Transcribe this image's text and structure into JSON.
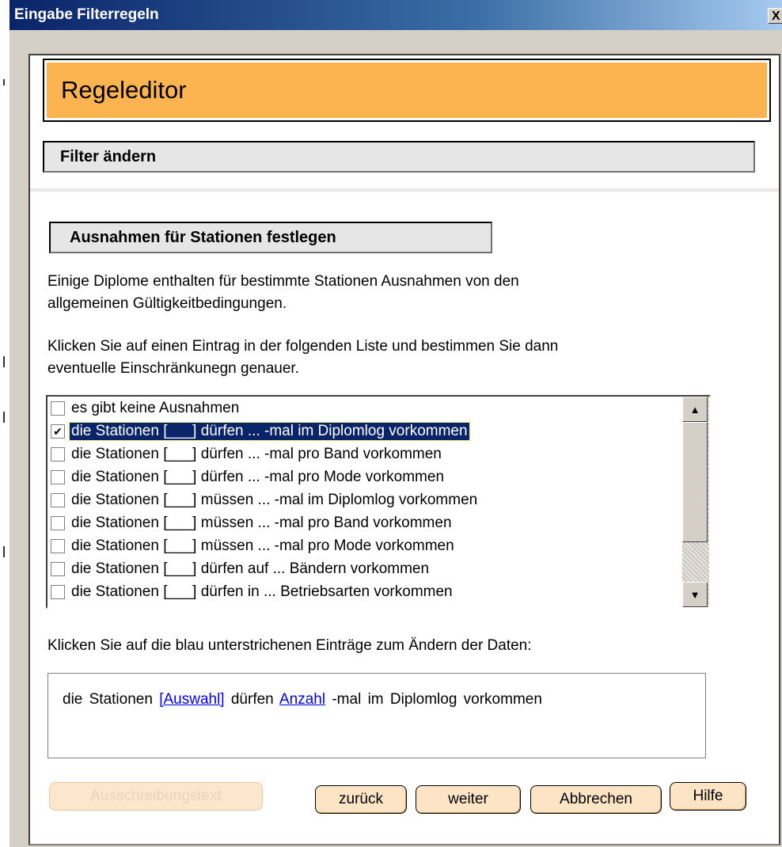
{
  "window": {
    "title": "Eingabe Filterregeln",
    "close_glyph": "X"
  },
  "header": {
    "title": "Regeleditor"
  },
  "subheader": {
    "title": "Filter ändern"
  },
  "section": {
    "title": "Ausnahmen für  Stationen festlegen"
  },
  "intro": {
    "line1": "Einige Diplome enthalten für bestimmte Stationen Ausnahmen von den",
    "line2": "allgemeinen Gültigkeitbedingungen.",
    "line3": "Klicken Sie auf einen Eintrag in der folgenden Liste und bestimmen Sie dann",
    "line4": "eventuelle Einschränkunegn genauer."
  },
  "list": {
    "items": [
      {
        "label": "es gibt keine Ausnahmen",
        "checked": false
      },
      {
        "label": "die Stationen [___] dürfen ... -mal im Diplomlog vorkommen",
        "checked": true
      },
      {
        "label": "die Stationen [___] dürfen ... -mal pro Band vorkommen",
        "checked": false
      },
      {
        "label": "die Stationen [___] dürfen ... -mal pro Mode vorkommen",
        "checked": false
      },
      {
        "label": "die Stationen [___] müssen ... -mal im Diplomlog vorkommen",
        "checked": false
      },
      {
        "label": "die Stationen [___] müssen ... -mal pro Band vorkommen",
        "checked": false
      },
      {
        "label": "die Stationen [___] müssen ... -mal pro Mode vorkommen",
        "checked": false
      },
      {
        "label": "die Stationen [___] dürfen auf ... Bändern vorkommen",
        "checked": false
      },
      {
        "label": "die Stationen [___] dürfen in ... Betriebsarten vorkommen",
        "checked": false
      }
    ],
    "scroll_up": "▲",
    "scroll_down": "▼"
  },
  "hint": {
    "text": "Klicken Sie auf die blau unterstrichenen Einträge zum Ändern der Daten:"
  },
  "editor": {
    "prefix": "die Stationen",
    "link_selection": "[Auswahl]",
    "middle": "dürfen",
    "link_count": "Anzahl",
    "suffix": "-mal im Diplomlog vorkommen"
  },
  "buttons": {
    "ausschreibung": "Ausschreibungstext",
    "back": "zurück",
    "next": "weiter",
    "cancel": "Abbrechen",
    "help": "Hilfe"
  },
  "colors": {
    "header_bg": "#fbb450",
    "selection_bg": "#0a246a",
    "link": "#0000ee",
    "button_bg": "#fde4c4"
  }
}
